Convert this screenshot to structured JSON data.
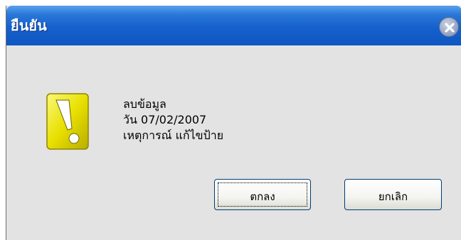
{
  "dialog": {
    "title": "ยืนยัน",
    "close_icon": "close-icon",
    "warning_icon": "exclamation-warning-icon",
    "message_lines": [
      "ลบข้อมูล",
      "วัน 07/02/2007",
      "เหตุการณ์ แก้ไขป้าย"
    ],
    "ok_label": "ตกลง",
    "cancel_label": "ยกเลิก",
    "colors": {
      "titlebar": "#1560cc",
      "background": "#e3e3e3",
      "warning_yellow": "#e8e000"
    }
  }
}
